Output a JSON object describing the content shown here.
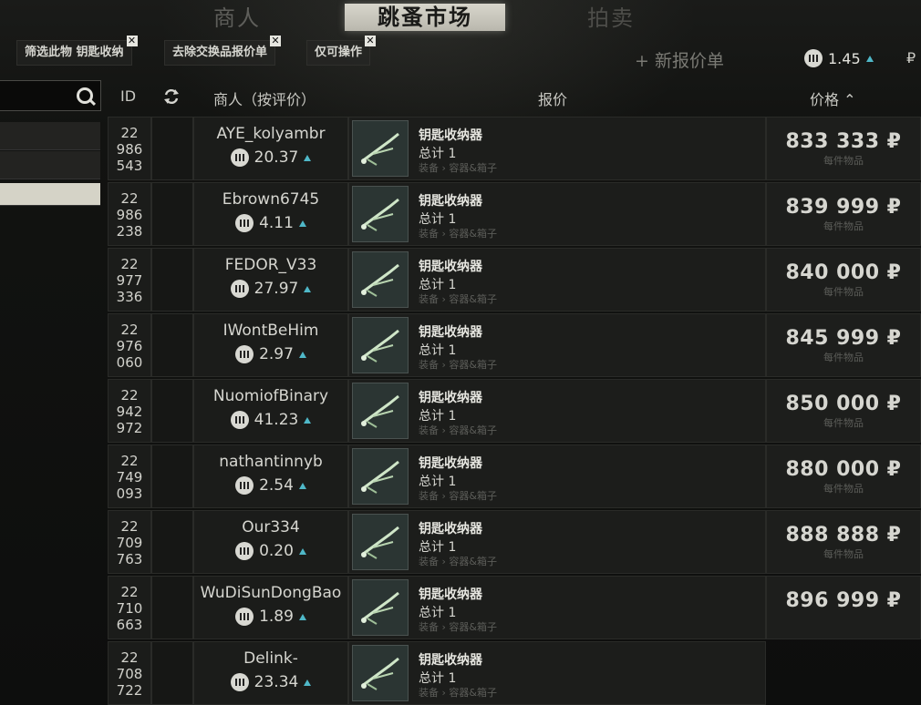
{
  "tabs": {
    "traders": "商人",
    "flea": "跳蚤市场",
    "auction": "拍卖"
  },
  "filters": [
    {
      "label": "筛选此物 钥匙收纳",
      "close": "✕"
    },
    {
      "label": "去除交换品报价单",
      "close": "✕"
    },
    {
      "label": "仅可操作",
      "close": "✕"
    }
  ],
  "new_offer": "+ 新报价单",
  "player": {
    "rating": "1.45",
    "currency": "₽"
  },
  "headers": {
    "id": "ID",
    "trader": "商人（按评价）",
    "offer": "报价",
    "price": "价格 ⌃"
  },
  "colors": {
    "accent_up": "#4fb8c8",
    "active_tab": "#d8d6cc"
  },
  "icons": {
    "search": "search-icon",
    "refresh": "refresh-icon",
    "rating": "rating-badge-icon",
    "item": "key-tool-icon"
  },
  "rows": [
    {
      "id1": "22",
      "id2": "986",
      "id3": "543",
      "trader": "AYE_kolyambr",
      "rating": "20.37",
      "item": "钥匙收纳器",
      "qty": "总计 1",
      "cat": "装备 › 容器&箱子",
      "price": "833 333 ₽",
      "unit": "每件物品"
    },
    {
      "id1": "22",
      "id2": "986",
      "id3": "238",
      "trader": "Ebrown6745",
      "rating": "4.11",
      "item": "钥匙收纳器",
      "qty": "总计 1",
      "cat": "装备 › 容器&箱子",
      "price": "839 999 ₽",
      "unit": "每件物品"
    },
    {
      "id1": "22",
      "id2": "977",
      "id3": "336",
      "trader": "FEDOR_V33",
      "rating": "27.97",
      "item": "钥匙收纳器",
      "qty": "总计 1",
      "cat": "装备 › 容器&箱子",
      "price": "840 000 ₽",
      "unit": "每件物品"
    },
    {
      "id1": "22",
      "id2": "976",
      "id3": "060",
      "trader": "IWontBeHim",
      "rating": "2.97",
      "item": "钥匙收纳器",
      "qty": "总计 1",
      "cat": "装备 › 容器&箱子",
      "price": "845 999 ₽",
      "unit": "每件物品"
    },
    {
      "id1": "22",
      "id2": "942",
      "id3": "972",
      "trader": "NuomiofBinary",
      "rating": "41.23",
      "item": "钥匙收纳器",
      "qty": "总计 1",
      "cat": "装备 › 容器&箱子",
      "price": "850 000 ₽",
      "unit": "每件物品"
    },
    {
      "id1": "22",
      "id2": "749",
      "id3": "093",
      "trader": "nathantinnyb",
      "rating": "2.54",
      "item": "钥匙收纳器",
      "qty": "总计 1",
      "cat": "装备 › 容器&箱子",
      "price": "880 000 ₽",
      "unit": "每件物品"
    },
    {
      "id1": "22",
      "id2": "709",
      "id3": "763",
      "trader": "Our334",
      "rating": "0.20",
      "item": "钥匙收纳器",
      "qty": "总计 1",
      "cat": "装备 › 容器&箱子",
      "price": "888 888 ₽",
      "unit": "每件物品"
    },
    {
      "id1": "22",
      "id2": "710",
      "id3": "663",
      "trader": "WuDiSunDongBao",
      "rating": "1.89",
      "item": "钥匙收纳器",
      "qty": "总计 1",
      "cat": "装备 › 容器&箱子",
      "price": "896 999 ₽",
      "unit": ""
    },
    {
      "id1": "22",
      "id2": "708",
      "id3": "722",
      "trader": "Delink-",
      "rating": "23.34",
      "item": "钥匙收纳器",
      "qty": "总计 1",
      "cat": "装备 › 容器&箱子",
      "price": "",
      "unit": ""
    }
  ]
}
